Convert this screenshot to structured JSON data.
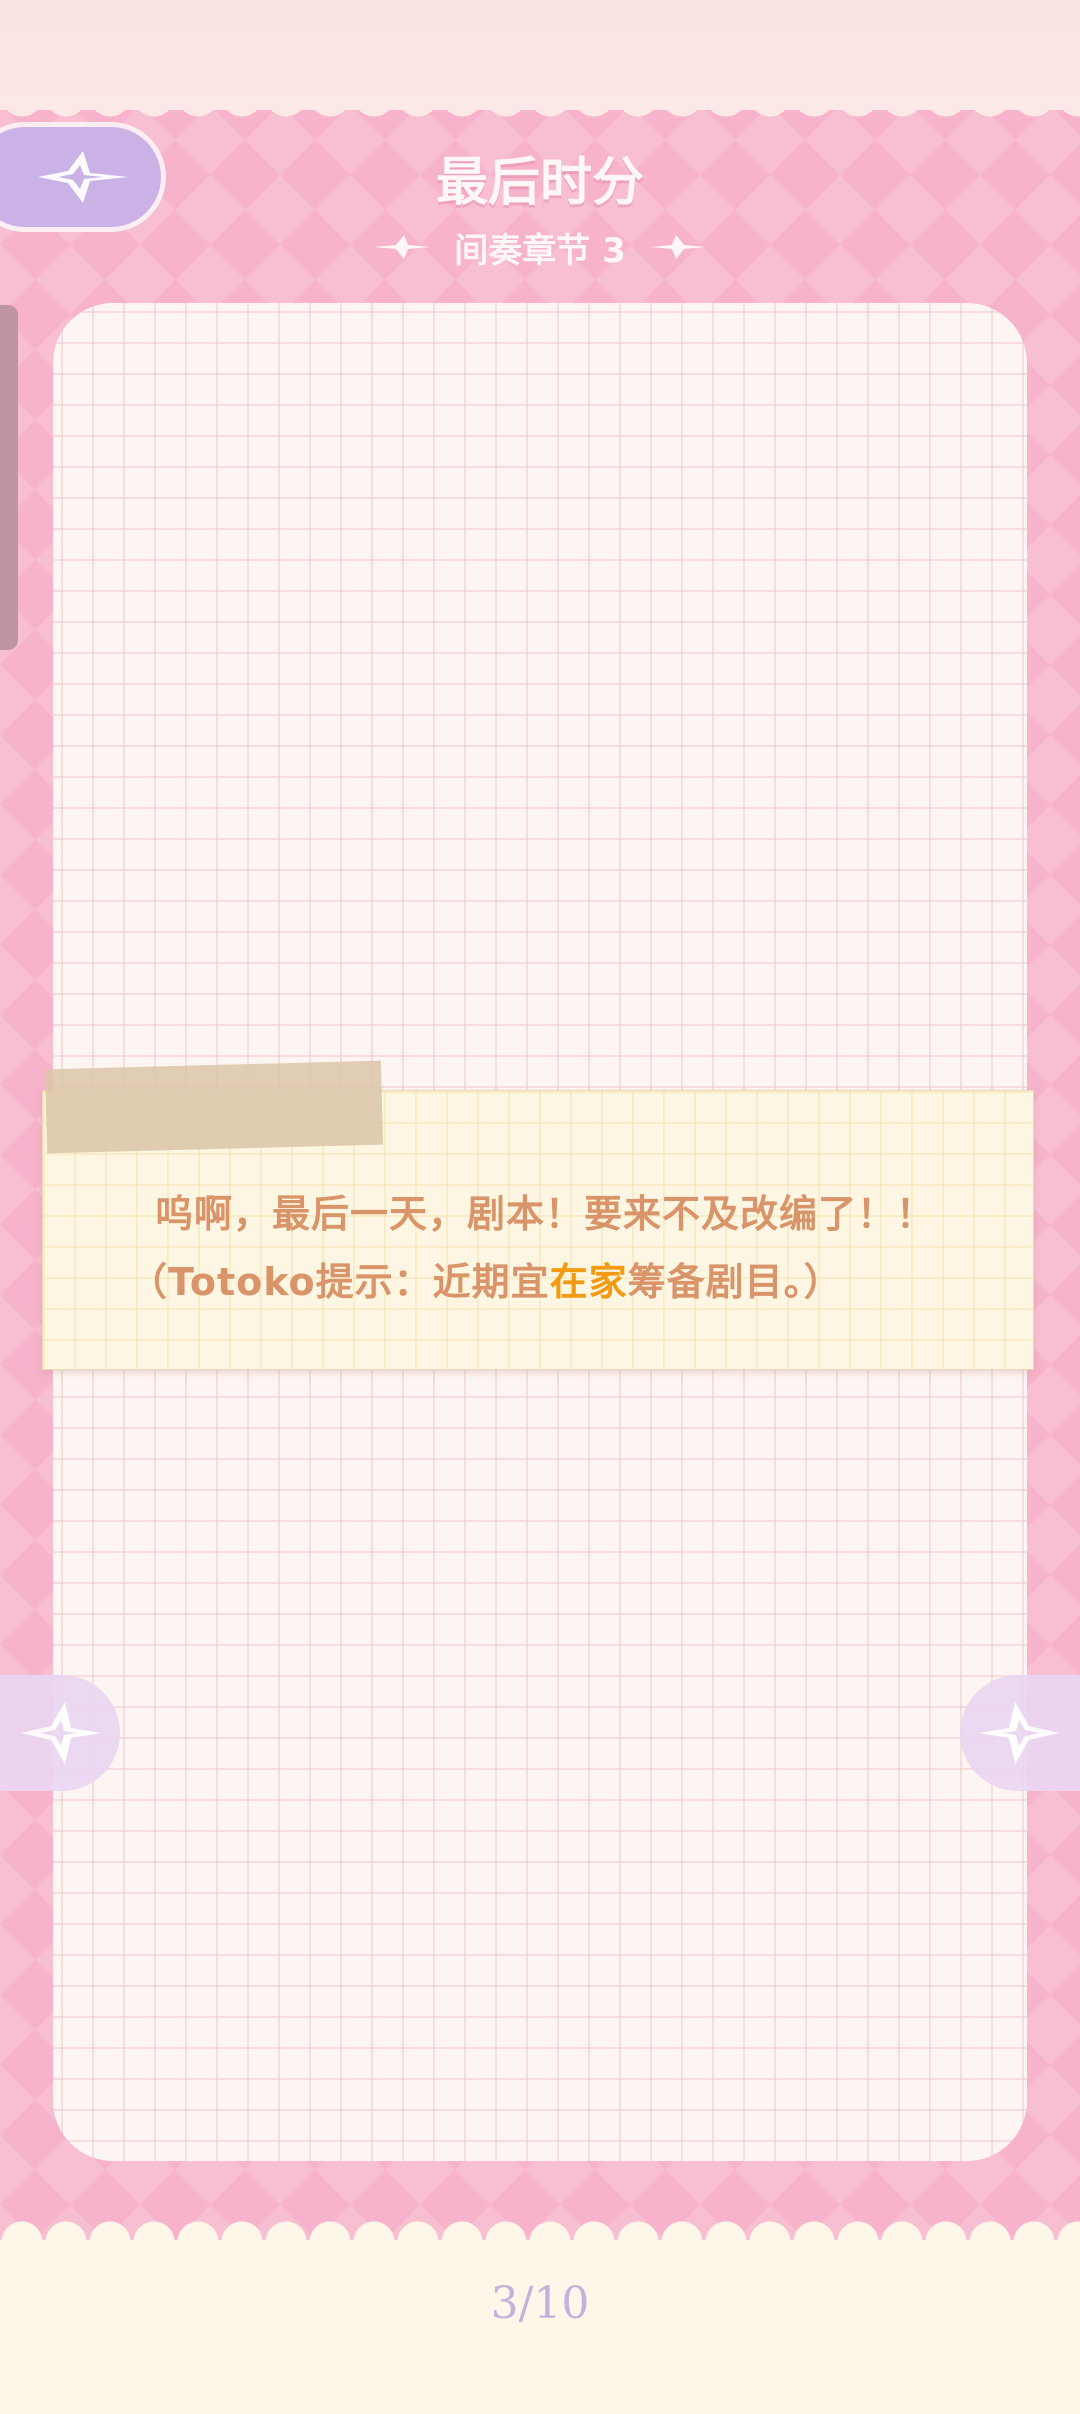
{
  "header": {
    "title": "最后时分",
    "subtitle": "间奏章节 3"
  },
  "icons": {
    "back": "sparkle-back-icon",
    "prev": "sparkle-left-arrow-icon",
    "next": "sparkle-right-arrow-icon"
  },
  "note": {
    "line1": "呜啊，最后一天，剧本！要来不及改编了！！",
    "line2_prefix": "（Totoko提示：近期宜",
    "line2_highlight": "在家",
    "line2_suffix": "筹备剧目。）"
  },
  "pager": {
    "label": "3/10"
  },
  "colors": {
    "background_pink": "#f7b3cb",
    "note_text": "#d9946a",
    "highlight": "#f29b12",
    "counter": "#c2b3dd",
    "back_button": "#cbb2e6"
  }
}
